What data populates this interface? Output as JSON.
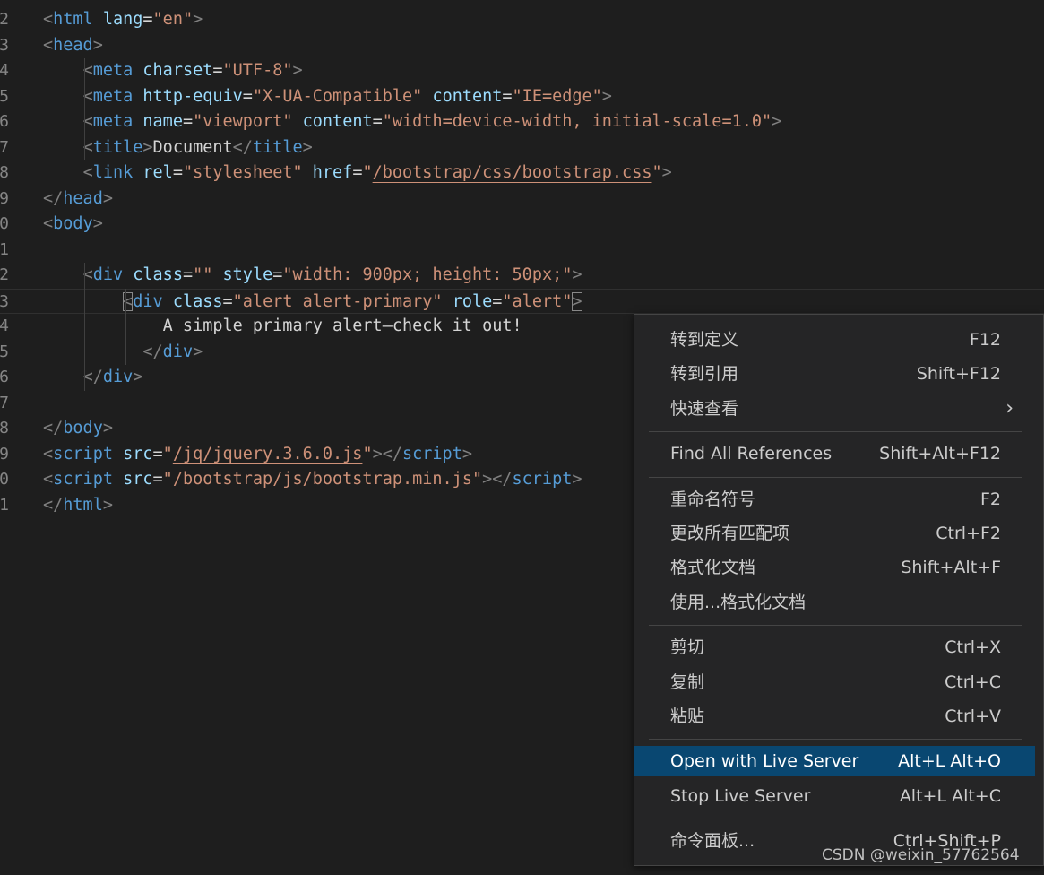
{
  "editor": {
    "lines": [
      {
        "num": "2",
        "tokens": [
          {
            "t": "<",
            "c": "punct"
          },
          {
            "t": "html",
            "c": "tag"
          },
          {
            "t": " "
          },
          {
            "t": "lang",
            "c": "attr"
          },
          {
            "t": "=",
            "c": "text"
          },
          {
            "t": "\"en\"",
            "c": "str"
          },
          {
            "t": ">",
            "c": "punct"
          }
        ]
      },
      {
        "num": "3",
        "tokens": [
          {
            "t": "<",
            "c": "punct"
          },
          {
            "t": "head",
            "c": "tag"
          },
          {
            "t": ">",
            "c": "punct"
          }
        ]
      },
      {
        "num": "4",
        "tokens": [
          {
            "t": "    "
          },
          {
            "t": "<",
            "c": "punct"
          },
          {
            "t": "meta",
            "c": "tag"
          },
          {
            "t": " "
          },
          {
            "t": "charset",
            "c": "attr"
          },
          {
            "t": "=",
            "c": "text"
          },
          {
            "t": "\"UTF-8\"",
            "c": "str"
          },
          {
            "t": ">",
            "c": "punct"
          }
        ]
      },
      {
        "num": "5",
        "tokens": [
          {
            "t": "    "
          },
          {
            "t": "<",
            "c": "punct"
          },
          {
            "t": "meta",
            "c": "tag"
          },
          {
            "t": " "
          },
          {
            "t": "http-equiv",
            "c": "attr"
          },
          {
            "t": "=",
            "c": "text"
          },
          {
            "t": "\"X-UA-Compatible\"",
            "c": "str"
          },
          {
            "t": " "
          },
          {
            "t": "content",
            "c": "attr"
          },
          {
            "t": "=",
            "c": "text"
          },
          {
            "t": "\"IE=edge\"",
            "c": "str"
          },
          {
            "t": ">",
            "c": "punct"
          }
        ]
      },
      {
        "num": "6",
        "tokens": [
          {
            "t": "    "
          },
          {
            "t": "<",
            "c": "punct"
          },
          {
            "t": "meta",
            "c": "tag"
          },
          {
            "t": " "
          },
          {
            "t": "name",
            "c": "attr"
          },
          {
            "t": "=",
            "c": "text"
          },
          {
            "t": "\"viewport\"",
            "c": "str"
          },
          {
            "t": " "
          },
          {
            "t": "content",
            "c": "attr"
          },
          {
            "t": "=",
            "c": "text"
          },
          {
            "t": "\"width=device-width, initial-scale=1.0\"",
            "c": "str"
          },
          {
            "t": ">",
            "c": "punct"
          }
        ]
      },
      {
        "num": "7",
        "tokens": [
          {
            "t": "    "
          },
          {
            "t": "<",
            "c": "punct"
          },
          {
            "t": "title",
            "c": "tag"
          },
          {
            "t": ">",
            "c": "punct"
          },
          {
            "t": "Document",
            "c": "text"
          },
          {
            "t": "</",
            "c": "punct"
          },
          {
            "t": "title",
            "c": "tag"
          },
          {
            "t": ">",
            "c": "punct"
          }
        ]
      },
      {
        "num": "8",
        "tokens": [
          {
            "t": "    "
          },
          {
            "t": "<",
            "c": "punct"
          },
          {
            "t": "link",
            "c": "tag"
          },
          {
            "t": " "
          },
          {
            "t": "rel",
            "c": "attr"
          },
          {
            "t": "=",
            "c": "text"
          },
          {
            "t": "\"stylesheet\"",
            "c": "str"
          },
          {
            "t": " "
          },
          {
            "t": "href",
            "c": "attr"
          },
          {
            "t": "=",
            "c": "text"
          },
          {
            "t": "\"",
            "c": "str"
          },
          {
            "t": "/bootstrap/css/bootstrap.css",
            "c": "str",
            "link": true
          },
          {
            "t": "\"",
            "c": "str"
          },
          {
            "t": ">",
            "c": "punct"
          }
        ]
      },
      {
        "num": "9",
        "tokens": [
          {
            "t": "</",
            "c": "punct"
          },
          {
            "t": "head",
            "c": "tag"
          },
          {
            "t": ">",
            "c": "punct"
          }
        ]
      },
      {
        "num": "0",
        "tokens": [
          {
            "t": "<",
            "c": "punct"
          },
          {
            "t": "body",
            "c": "tag"
          },
          {
            "t": ">",
            "c": "punct"
          }
        ]
      },
      {
        "num": "1",
        "tokens": []
      },
      {
        "num": "2",
        "tokens": [
          {
            "t": "    "
          },
          {
            "t": "<",
            "c": "punct"
          },
          {
            "t": "div",
            "c": "tag"
          },
          {
            "t": " "
          },
          {
            "t": "class",
            "c": "attr"
          },
          {
            "t": "=",
            "c": "text"
          },
          {
            "t": "\"\"",
            "c": "str"
          },
          {
            "t": " "
          },
          {
            "t": "style",
            "c": "attr"
          },
          {
            "t": "=",
            "c": "text"
          },
          {
            "t": "\"width: 900px; height: 50px;\"",
            "c": "str"
          },
          {
            "t": ">",
            "c": "punct"
          }
        ]
      },
      {
        "num": "3",
        "current": true,
        "tokens": [
          {
            "t": "        "
          },
          {
            "t": "<",
            "c": "punct",
            "box": true
          },
          {
            "t": "div",
            "c": "tag"
          },
          {
            "t": " "
          },
          {
            "t": "class",
            "c": "attr"
          },
          {
            "t": "=",
            "c": "text"
          },
          {
            "t": "\"alert alert-primary\"",
            "c": "str"
          },
          {
            "t": " "
          },
          {
            "t": "role",
            "c": "attr"
          },
          {
            "t": "=",
            "c": "text"
          },
          {
            "t": "\"alert\"",
            "c": "str"
          },
          {
            "t": ">",
            "c": "punct",
            "box": true
          }
        ]
      },
      {
        "num": "4",
        "tokens": [
          {
            "t": "            "
          },
          {
            "t": "A simple primary alert—check it out!",
            "c": "text"
          }
        ]
      },
      {
        "num": "5",
        "tokens": [
          {
            "t": "          "
          },
          {
            "t": "</",
            "c": "punct"
          },
          {
            "t": "div",
            "c": "tag"
          },
          {
            "t": ">",
            "c": "punct"
          }
        ]
      },
      {
        "num": "6",
        "tokens": [
          {
            "t": "    "
          },
          {
            "t": "</",
            "c": "punct"
          },
          {
            "t": "div",
            "c": "tag"
          },
          {
            "t": ">",
            "c": "punct"
          }
        ]
      },
      {
        "num": "7",
        "tokens": []
      },
      {
        "num": "8",
        "tokens": [
          {
            "t": "</",
            "c": "punct"
          },
          {
            "t": "body",
            "c": "tag"
          },
          {
            "t": ">",
            "c": "punct"
          }
        ]
      },
      {
        "num": "9",
        "tokens": [
          {
            "t": "<",
            "c": "punct"
          },
          {
            "t": "script",
            "c": "tag"
          },
          {
            "t": " "
          },
          {
            "t": "src",
            "c": "attr"
          },
          {
            "t": "=",
            "c": "text"
          },
          {
            "t": "\"",
            "c": "str"
          },
          {
            "t": "/jq/jquery.3.6.0.js",
            "c": "str",
            "link": true
          },
          {
            "t": "\"",
            "c": "str"
          },
          {
            "t": "></",
            "c": "punct"
          },
          {
            "t": "script",
            "c": "tag"
          },
          {
            "t": ">",
            "c": "punct"
          }
        ]
      },
      {
        "num": "0",
        "tokens": [
          {
            "t": "<",
            "c": "punct"
          },
          {
            "t": "script",
            "c": "tag"
          },
          {
            "t": " "
          },
          {
            "t": "src",
            "c": "attr"
          },
          {
            "t": "=",
            "c": "text"
          },
          {
            "t": "\"",
            "c": "str"
          },
          {
            "t": "/bootstrap/js/bootstrap.min.js",
            "c": "str",
            "link": true
          },
          {
            "t": "\"",
            "c": "str"
          },
          {
            "t": "></",
            "c": "punct"
          },
          {
            "t": "script",
            "c": "tag"
          },
          {
            "t": ">",
            "c": "punct"
          }
        ]
      },
      {
        "num": "1",
        "tokens": [
          {
            "t": "</",
            "c": "punct"
          },
          {
            "t": "html",
            "c": "tag"
          },
          {
            "t": ">",
            "c": "punct"
          }
        ]
      }
    ]
  },
  "context_menu": {
    "groups": [
      [
        {
          "label": "转到定义",
          "key": "F12"
        },
        {
          "label": "转到引用",
          "key": "Shift+F12"
        },
        {
          "label": "快速查看",
          "key": "",
          "submenu": true
        }
      ],
      [
        {
          "label": "Find All References",
          "key": "Shift+Alt+F12"
        }
      ],
      [
        {
          "label": "重命名符号",
          "key": "F2"
        },
        {
          "label": "更改所有匹配项",
          "key": "Ctrl+F2"
        },
        {
          "label": "格式化文档",
          "key": "Shift+Alt+F"
        },
        {
          "label": "使用...格式化文档",
          "key": ""
        }
      ],
      [
        {
          "label": "剪切",
          "key": "Ctrl+X"
        },
        {
          "label": "复制",
          "key": "Ctrl+C"
        },
        {
          "label": "粘贴",
          "key": "Ctrl+V"
        }
      ],
      [
        {
          "label": "Open with Live Server",
          "key": "Alt+L Alt+O",
          "selected": true
        },
        {
          "label": "Stop Live Server",
          "key": "Alt+L Alt+C"
        }
      ],
      [
        {
          "label": "命令面板...",
          "key": "Ctrl+Shift+P"
        }
      ]
    ]
  },
  "watermark": "CSDN @weixin_57762564"
}
